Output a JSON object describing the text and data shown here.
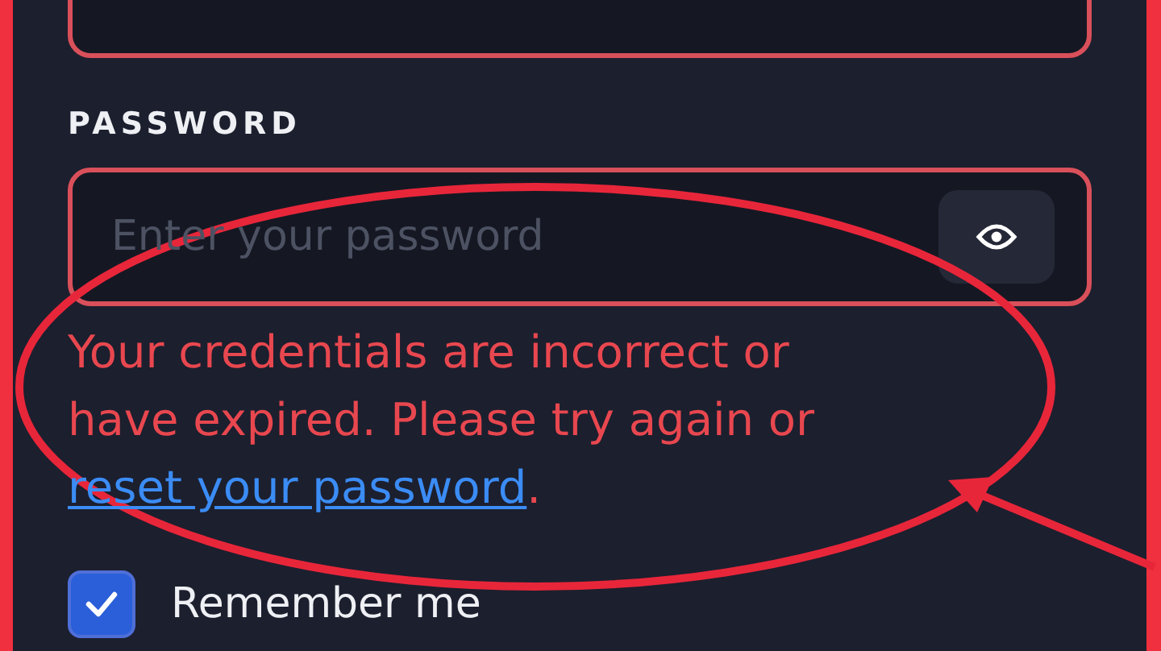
{
  "password": {
    "label": "PASSWORD",
    "placeholder": "Enter your password"
  },
  "error": {
    "text": "Your credentials are incorrect or have expired. Please try again or ",
    "link": "reset your password",
    "end": "."
  },
  "remember": {
    "label": "Remember me",
    "checked": true
  }
}
